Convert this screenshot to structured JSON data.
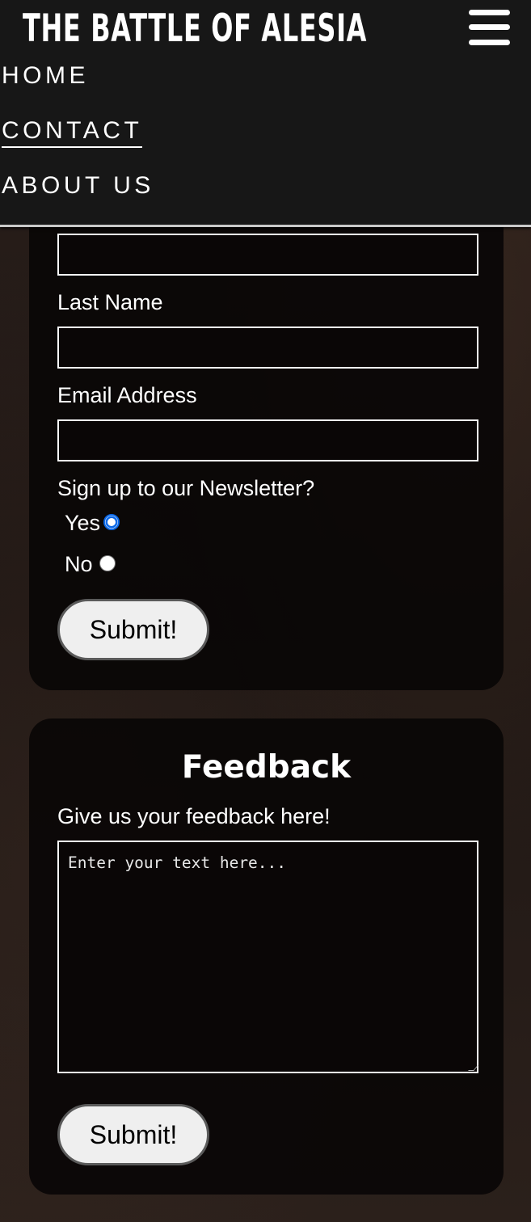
{
  "header": {
    "title": "THE BATTLE OF ALESIA",
    "menu_icon": "hamburger-menu-icon"
  },
  "nav": {
    "items": [
      {
        "label": "HOME",
        "active": false
      },
      {
        "label": "CONTACT",
        "active": true
      },
      {
        "label": "ABOUT US",
        "active": false
      }
    ]
  },
  "contact_form": {
    "first_name_value": "",
    "last_name_label": "Last Name",
    "last_name_value": "",
    "email_label": "Email Address",
    "email_value": "",
    "newsletter_label": "Sign up to our Newsletter?",
    "newsletter_options": [
      {
        "label": "Yes",
        "selected": true
      },
      {
        "label": "No",
        "selected": false
      }
    ],
    "submit_label": "Submit!"
  },
  "feedback_form": {
    "heading": "Feedback",
    "prompt": "Give us your feedback here!",
    "textarea_placeholder": "Enter your text here...",
    "textarea_value": "",
    "submit_label": "Submit!"
  },
  "colors": {
    "header_bg": "#171717",
    "card_bg": "#0a0606",
    "radio_accent": "#0a68e8",
    "button_bg": "#efefef"
  }
}
